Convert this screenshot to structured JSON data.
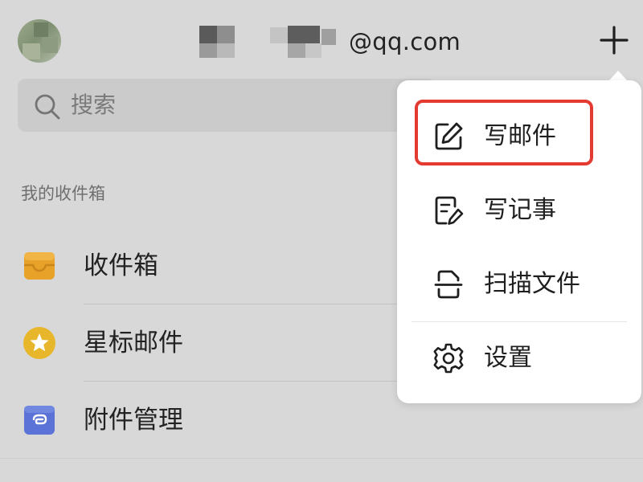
{
  "header": {
    "account_suffix": "@qq.com",
    "avatar_icon": "avatar-image",
    "add_icon": "plus-icon"
  },
  "search": {
    "placeholder": "搜索",
    "icon": "search-icon"
  },
  "mailbox_section": {
    "title": "我的收件箱",
    "items": [
      {
        "label": "收件箱",
        "icon": "inbox-tray-icon",
        "color": "#e8a22a"
      },
      {
        "label": "星标邮件",
        "icon": "star-circle-icon",
        "color": "#e8b62a"
      },
      {
        "label": "附件管理",
        "icon": "attachment-clip-icon",
        "color": "#5b72d6"
      }
    ]
  },
  "popup_menu": {
    "items": [
      {
        "label": "写邮件",
        "icon": "compose-edit-icon",
        "highlighted": true
      },
      {
        "label": "写记事",
        "icon": "note-edit-icon"
      },
      {
        "label": "扫描文件",
        "icon": "scan-document-icon"
      },
      {
        "label": "设置",
        "icon": "gear-icon"
      }
    ],
    "highlight_color": "#e33a32"
  }
}
